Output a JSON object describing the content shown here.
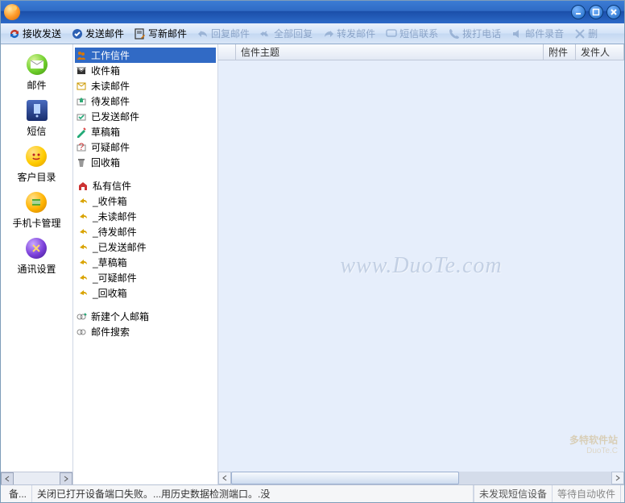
{
  "toolbar": {
    "receive_send": "接收发送",
    "send_mail": "发送邮件",
    "compose": "写新邮件",
    "reply": "回复邮件",
    "reply_all": "全部回复",
    "forward": "转发邮件",
    "sms_record": "短信联系",
    "dial": "拨打电话",
    "mail_audio": "邮件录音",
    "delete": "删"
  },
  "sidebar": {
    "mail": "邮件",
    "sms": "短信",
    "contacts": "客户目录",
    "sim": "手机卡管理",
    "comm": "通讯设置"
  },
  "tree": {
    "work": [
      {
        "label": "工作信件",
        "icon": "people"
      },
      {
        "label": "收件箱",
        "icon": "inbox"
      },
      {
        "label": "未读邮件",
        "icon": "unread"
      },
      {
        "label": "待发邮件",
        "icon": "outbox"
      },
      {
        "label": "已发送邮件",
        "icon": "sent"
      },
      {
        "label": "草稿箱",
        "icon": "draft"
      },
      {
        "label": "可疑邮件",
        "icon": "spam"
      },
      {
        "label": "回收箱",
        "icon": "trash"
      }
    ],
    "private": [
      {
        "label": "私有信件",
        "icon": "home"
      },
      {
        "label": "_收件箱",
        "icon": "priv"
      },
      {
        "label": "_未读邮件",
        "icon": "priv"
      },
      {
        "label": "_待发邮件",
        "icon": "priv"
      },
      {
        "label": "_已发送邮件",
        "icon": "priv"
      },
      {
        "label": "_草稿箱",
        "icon": "priv"
      },
      {
        "label": "_可疑邮件",
        "icon": "priv"
      },
      {
        "label": "_回收箱",
        "icon": "priv"
      }
    ],
    "tools": [
      {
        "label": "新建个人邮箱",
        "icon": "newbox"
      },
      {
        "label": "邮件搜索",
        "icon": "search"
      }
    ]
  },
  "list": {
    "col_subject": "信件主题",
    "col_attach": "附件",
    "col_sender": "发件人"
  },
  "watermark": "www.DuoTe.com",
  "brand": {
    "name": "多特软件站",
    "sub": "DuoTe.C"
  },
  "status": {
    "left1": "备...",
    "left2": "关闭已打开设备端口失败。...用历史数据检测端口。.没",
    "right1": "未发现短信设备",
    "right2": "等待自动收件"
  }
}
